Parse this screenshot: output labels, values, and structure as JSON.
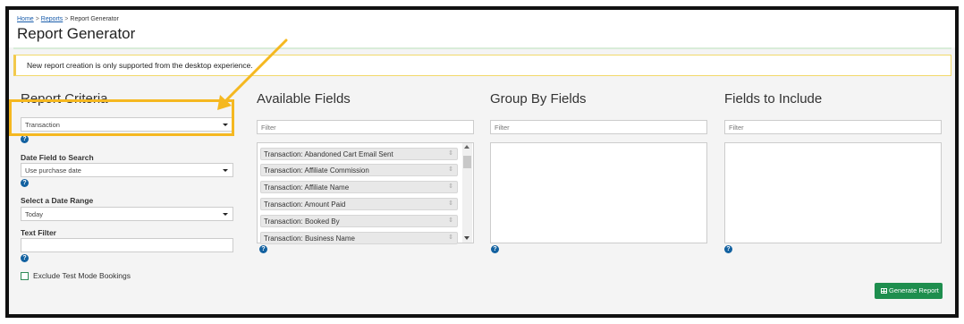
{
  "breadcrumb": {
    "home": "Home",
    "reports": "Reports",
    "current": "Report Generator",
    "separator": ">"
  },
  "page_title": "Report Generator",
  "alert_text": "New report creation is only supported from the desktop experience.",
  "report_criteria": {
    "title": "Report Criteria",
    "report_type": "Transaction",
    "date_field_label": "Date Field to Search",
    "date_field_value": "Use purchase date",
    "date_range_label": "Select a Date Range",
    "date_range_value": "Today",
    "text_filter_label": "Text Filter",
    "text_filter_value": "",
    "exclude_test_label": "Exclude Test Mode Bookings"
  },
  "available_fields": {
    "title": "Available Fields",
    "filter_placeholder": "Filter",
    "items": [
      "Transaction: Abandoned Cart Email Sent",
      "Transaction: Affiliate Commission",
      "Transaction: Affiliate Name",
      "Transaction: Amount Paid",
      "Transaction: Booked By",
      "Transaction: Business Name"
    ]
  },
  "group_by_fields": {
    "title": "Group By Fields",
    "filter_placeholder": "Filter"
  },
  "fields_to_include": {
    "title": "Fields to Include",
    "filter_placeholder": "Filter"
  },
  "help_glyph": "?",
  "drag_glyph": "⇕",
  "generate_button": "Generate Report",
  "colors": {
    "highlight": "#f5b820",
    "button": "#1e8e4e",
    "help": "#1261a0",
    "link": "#1a5dab"
  }
}
